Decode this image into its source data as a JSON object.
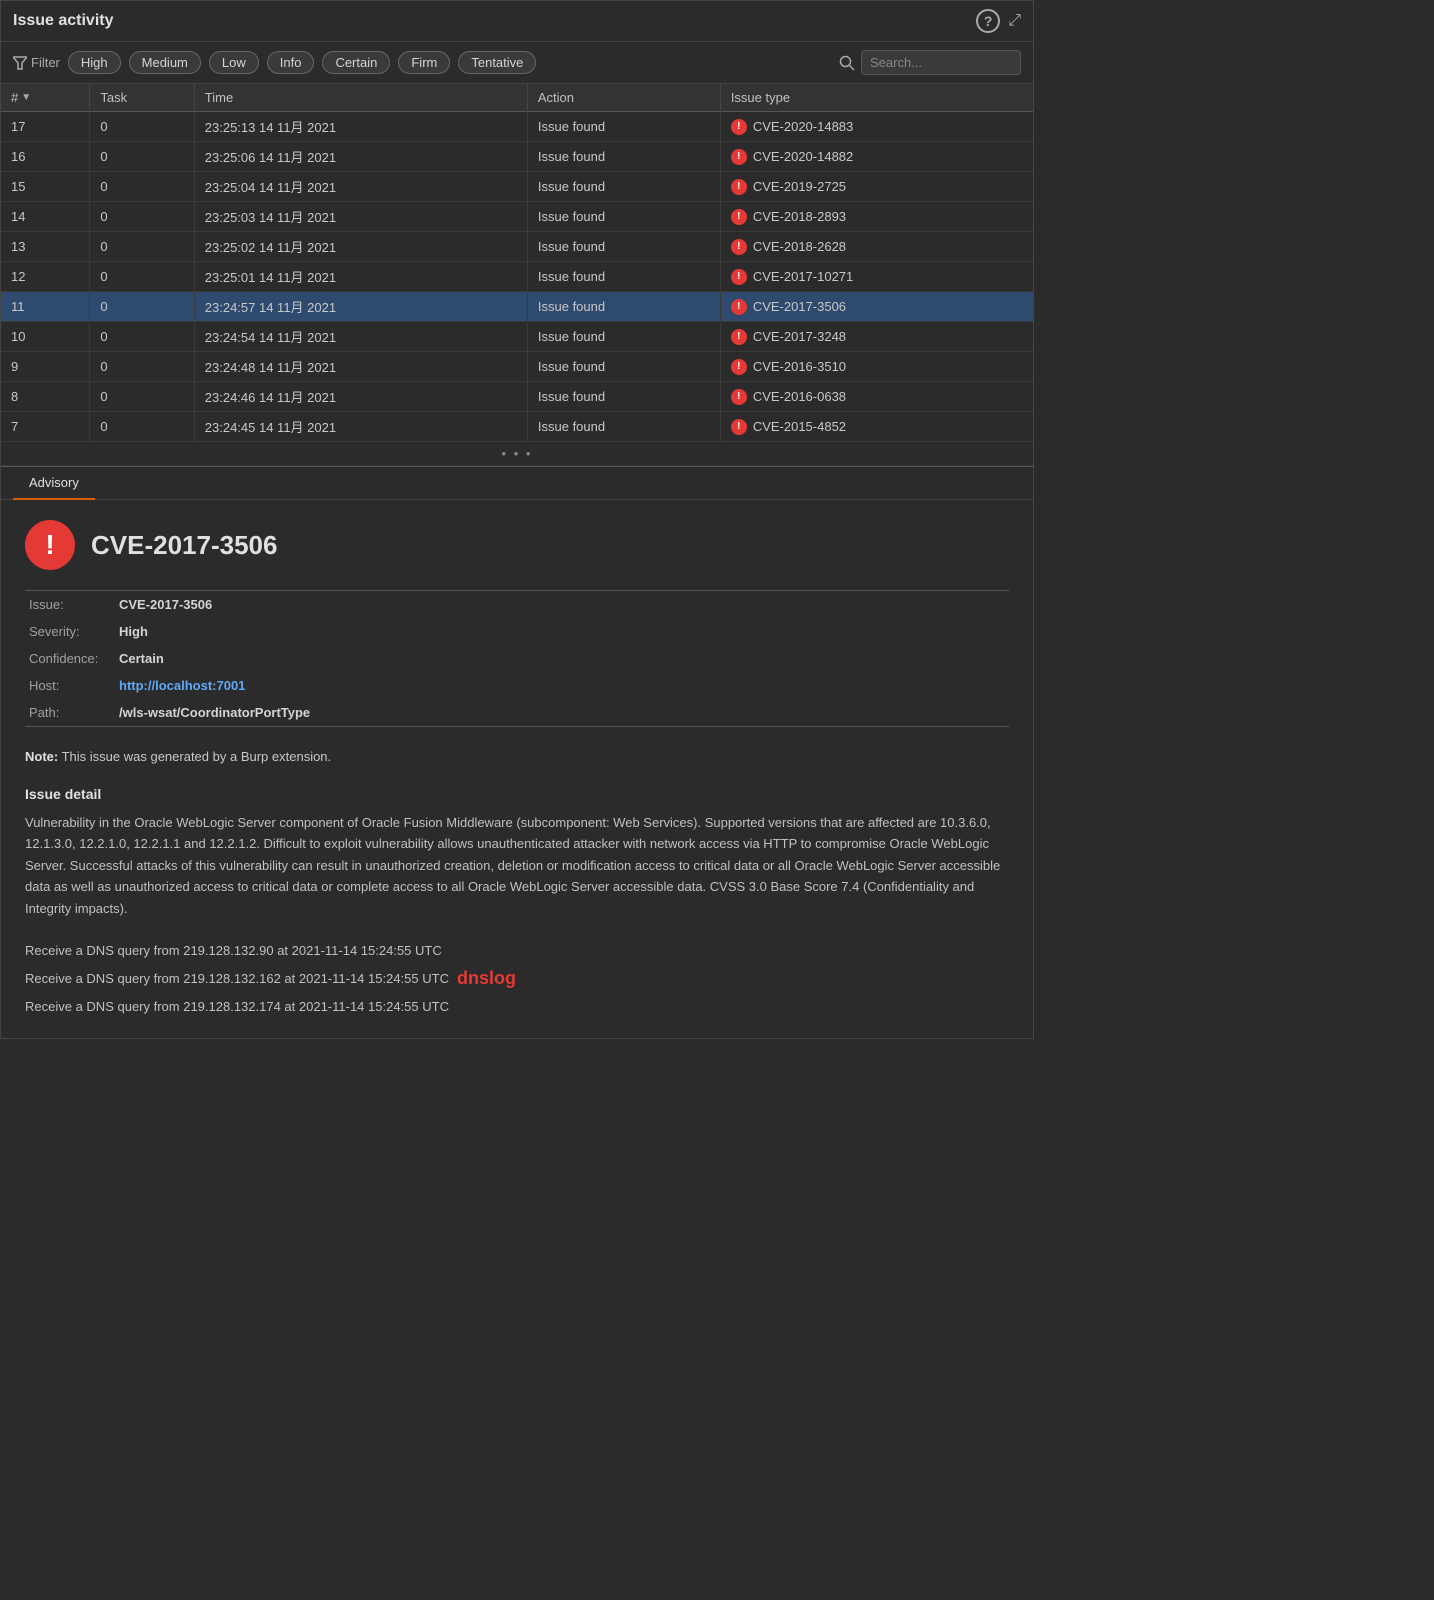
{
  "window": {
    "title": "Issue activity",
    "help_label": "?",
    "expand_label": "⤢"
  },
  "filter_bar": {
    "filter_label": "Filter",
    "buttons": [
      "High",
      "Medium",
      "Low",
      "Info",
      "Certain",
      "Firm",
      "Tentative"
    ],
    "search_placeholder": "Search..."
  },
  "table": {
    "columns": [
      "#",
      "Task",
      "Time",
      "Action",
      "Issue type"
    ],
    "rows": [
      {
        "id": 17,
        "task": 0,
        "time": "23:25:13 14 11月 2021",
        "action": "Issue found",
        "cve": "CVE-2020-14883",
        "selected": false
      },
      {
        "id": 16,
        "task": 0,
        "time": "23:25:06 14 11月 2021",
        "action": "Issue found",
        "cve": "CVE-2020-14882",
        "selected": false
      },
      {
        "id": 15,
        "task": 0,
        "time": "23:25:04 14 11月 2021",
        "action": "Issue found",
        "cve": "CVE-2019-2725",
        "selected": false
      },
      {
        "id": 14,
        "task": 0,
        "time": "23:25:03 14 11月 2021",
        "action": "Issue found",
        "cve": "CVE-2018-2893",
        "selected": false
      },
      {
        "id": 13,
        "task": 0,
        "time": "23:25:02 14 11月 2021",
        "action": "Issue found",
        "cve": "CVE-2018-2628",
        "selected": false
      },
      {
        "id": 12,
        "task": 0,
        "time": "23:25:01 14 11月 2021",
        "action": "Issue found",
        "cve": "CVE-2017-10271",
        "selected": false
      },
      {
        "id": 11,
        "task": 0,
        "time": "23:24:57 14 11月 2021",
        "action": "Issue found",
        "cve": "CVE-2017-3506",
        "selected": true
      },
      {
        "id": 10,
        "task": 0,
        "time": "23:24:54 14 11月 2021",
        "action": "Issue found",
        "cve": "CVE-2017-3248",
        "selected": false
      },
      {
        "id": 9,
        "task": 0,
        "time": "23:24:48 14 11月 2021",
        "action": "Issue found",
        "cve": "CVE-2016-3510",
        "selected": false
      },
      {
        "id": 8,
        "task": 0,
        "time": "23:24:46 14 11月 2021",
        "action": "Issue found",
        "cve": "CVE-2016-0638",
        "selected": false
      },
      {
        "id": 7,
        "task": 0,
        "time": "23:24:45 14 11月 2021",
        "action": "Issue found",
        "cve": "CVE-2015-4852",
        "selected": false
      }
    ]
  },
  "tabs": {
    "advisory": "Advisory"
  },
  "detail": {
    "cve_id": "CVE-2017-3506",
    "icon_label": "!",
    "fields": {
      "issue_label": "Issue:",
      "issue_value": "CVE-2017-3506",
      "severity_label": "Severity:",
      "severity_value": "High",
      "confidence_label": "Confidence:",
      "confidence_value": "Certain",
      "host_label": "Host:",
      "host_value": "http://localhost:7001",
      "path_label": "Path:",
      "path_value": "/wls-wsat/CoordinatorPortType"
    },
    "note": {
      "bold": "Note:",
      "text": " This issue was generated by a Burp extension."
    },
    "issue_detail_heading": "Issue detail",
    "issue_detail_text": "Vulnerability in the Oracle WebLogic Server component of Oracle Fusion Middleware (subcomponent: Web Services). Supported versions that are affected are 10.3.6.0, 12.1.3.0, 12.2.1.0, 12.2.1.1 and 12.2.1.2. Difficult to exploit vulnerability allows unauthenticated attacker with network access via HTTP to compromise Oracle WebLogic Server. Successful attacks of this vulnerability can result in unauthorized creation, deletion or modification access to critical data or all Oracle WebLogic Server accessible data as well as unauthorized access to critical data or complete access to all Oracle WebLogic Server accessible data. CVSS 3.0 Base Score 7.4 (Confidentiality and Integrity impacts).",
    "dns_lines": [
      "Receive a DNS query from 219.128.132.90 at 2021-11-14 15:24:55 UTC",
      "Receive a DNS query from 219.128.132.162 at 2021-11-14 15:24:55 UTC",
      "Receive a DNS query from 219.128.132.174 at 2021-11-14 15:24:55 UTC"
    ],
    "dnslog_label": "dnslog"
  }
}
